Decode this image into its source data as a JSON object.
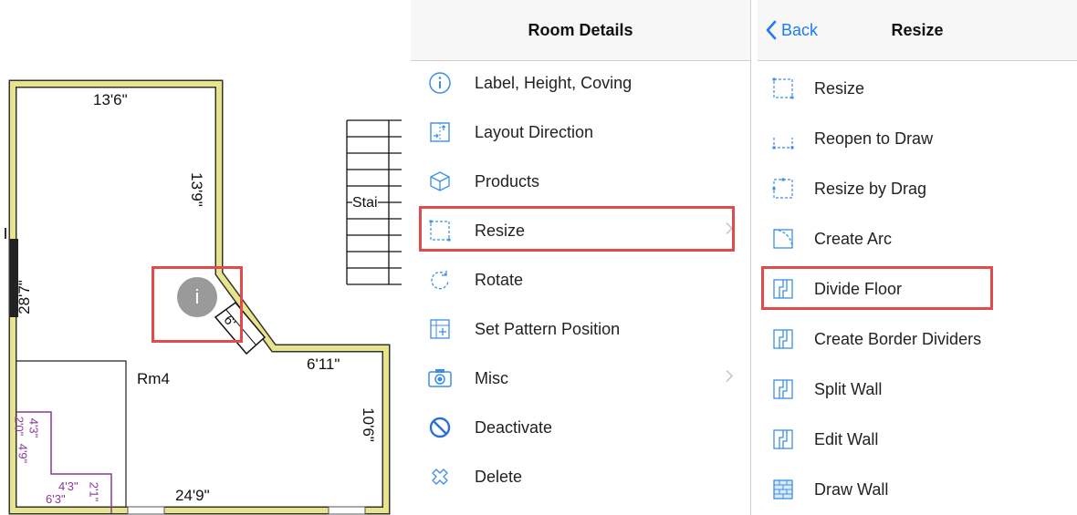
{
  "floorplan": {
    "dims": {
      "top": "13'6\"",
      "upper_right": "13'9\"",
      "left": "28'7\"",
      "diagonal": "6'",
      "step": "6'11\"",
      "right": "10'6\"",
      "bottom": "24'9\""
    },
    "room_label": "Rm4",
    "stairs_label": "Stai",
    "info_button": "i",
    "small_dims": [
      "2'0\"",
      "4'3\"",
      "4'9\"",
      "4'3\"",
      "6'3\"",
      "2'1\""
    ]
  },
  "room_details": {
    "title": "Room Details",
    "items": [
      {
        "label": "Label, Height, Coving",
        "icon": "info-icon"
      },
      {
        "label": "Layout Direction",
        "icon": "layout-direction-icon"
      },
      {
        "label": "Products",
        "icon": "products-box-icon"
      },
      {
        "label": "Resize",
        "icon": "resize-icon",
        "chevron": true,
        "highlighted": true
      },
      {
        "label": "Rotate",
        "icon": "rotate-icon"
      },
      {
        "label": "Set Pattern Position",
        "icon": "pattern-position-icon"
      },
      {
        "label": "Misc",
        "icon": "camera-icon",
        "chevron": true
      },
      {
        "label": "Deactivate",
        "icon": "deactivate-icon"
      },
      {
        "label": "Delete",
        "icon": "delete-icon"
      }
    ]
  },
  "resize_menu": {
    "back_label": "Back",
    "title": "Resize",
    "items": [
      {
        "label": "Resize",
        "icon": "resize-icon"
      },
      {
        "label": "Reopen to Draw",
        "icon": "reopen-draw-icon"
      },
      {
        "label": "Resize by Drag",
        "icon": "resize-drag-icon"
      },
      {
        "label": "Create Arc",
        "icon": "arc-icon"
      },
      {
        "label": "Divide Floor",
        "icon": "divide-floor-icon",
        "highlighted": true
      },
      {
        "label": "Create Border Dividers",
        "icon": "border-dividers-icon"
      },
      {
        "label": "Split Wall",
        "icon": "split-wall-icon"
      },
      {
        "label": "Edit Wall",
        "icon": "edit-wall-icon"
      },
      {
        "label": "Draw Wall",
        "icon": "draw-wall-icon"
      }
    ]
  },
  "colors": {
    "accent": "#1e7bf2",
    "highlight": "#e04c4c",
    "wall": "#e8e48c",
    "icon_blue": "#3b8ee8"
  }
}
